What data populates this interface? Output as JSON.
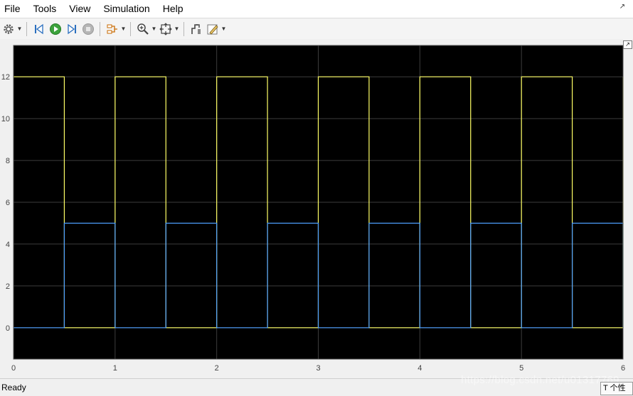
{
  "menu": {
    "items": [
      "File",
      "Tools",
      "View",
      "Simulation",
      "Help"
    ]
  },
  "toolbar": {
    "buttons": [
      {
        "name": "settings-icon"
      },
      {
        "name": "step-back-icon"
      },
      {
        "name": "run-icon"
      },
      {
        "name": "step-forward-icon"
      },
      {
        "name": "stop-icon"
      },
      {
        "name": "signal-highlight-icon"
      },
      {
        "name": "zoom-in-icon"
      },
      {
        "name": "fit-to-view-icon"
      },
      {
        "name": "cursor-measurement-icon"
      },
      {
        "name": "style-edit-icon"
      }
    ]
  },
  "status": {
    "text": "Ready"
  },
  "watermark": {
    "text": "https://blog.csdn.net/u01317769"
  },
  "corner": {
    "text": "T 个性"
  },
  "colors": {
    "plot_bg": "#000000",
    "grid": "#3c3c3c",
    "series1": "#ffff66",
    "series2": "#4d9fff",
    "tick_text": "#444444"
  },
  "chart_data": {
    "type": "line",
    "xlim": [
      0,
      6
    ],
    "ylim": [
      -1.5,
      13.5
    ],
    "xticks": [
      0,
      1,
      2,
      3,
      4,
      5,
      6
    ],
    "yticks": [
      0,
      2,
      4,
      6,
      8,
      10,
      12
    ],
    "grid": true,
    "series": [
      {
        "color": "#ffff66",
        "step": true,
        "x": [
          0,
          0.5,
          1,
          1.5,
          2,
          2.5,
          3,
          3.5,
          4,
          4.5,
          5,
          5.5,
          6
        ],
        "y": [
          12,
          0,
          12,
          0,
          12,
          0,
          12,
          0,
          12,
          0,
          12,
          0,
          12
        ]
      },
      {
        "color": "#4d9fff",
        "step": true,
        "x": [
          0,
          0.5,
          1,
          1.5,
          2,
          2.5,
          3,
          3.5,
          4,
          4.5,
          5,
          5.5,
          6
        ],
        "y": [
          0,
          5,
          0,
          5,
          0,
          5,
          0,
          5,
          0,
          5,
          0,
          5,
          0
        ]
      }
    ]
  }
}
